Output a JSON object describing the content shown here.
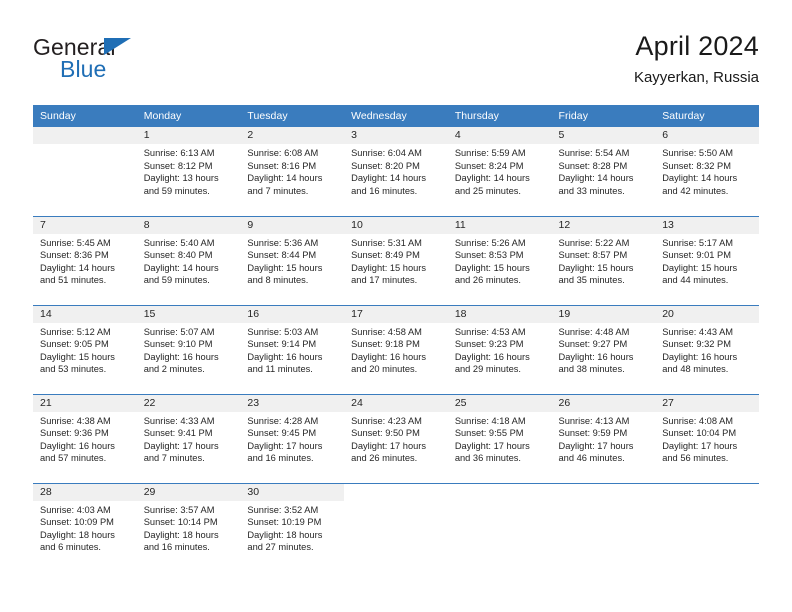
{
  "brand": {
    "name_part1": "General",
    "name_part2": "Blue",
    "accent_color": "#1f6eb5"
  },
  "header": {
    "title": "April 2024",
    "subtitle": "Kayyerkan, Russia"
  },
  "calendar": {
    "header_bg": "#3a7cbe",
    "daynum_bg": "#f0f0f0",
    "weekdays": [
      "Sunday",
      "Monday",
      "Tuesday",
      "Wednesday",
      "Thursday",
      "Friday",
      "Saturday"
    ],
    "weeks": [
      [
        {
          "day": "",
          "sunrise": "",
          "sunset": "",
          "daylight": "",
          "daylight2": "",
          "empty": true
        },
        {
          "day": "1",
          "sunrise": "Sunrise: 6:13 AM",
          "sunset": "Sunset: 8:12 PM",
          "daylight": "Daylight: 13 hours",
          "daylight2": "and 59 minutes."
        },
        {
          "day": "2",
          "sunrise": "Sunrise: 6:08 AM",
          "sunset": "Sunset: 8:16 PM",
          "daylight": "Daylight: 14 hours",
          "daylight2": "and 7 minutes."
        },
        {
          "day": "3",
          "sunrise": "Sunrise: 6:04 AM",
          "sunset": "Sunset: 8:20 PM",
          "daylight": "Daylight: 14 hours",
          "daylight2": "and 16 minutes."
        },
        {
          "day": "4",
          "sunrise": "Sunrise: 5:59 AM",
          "sunset": "Sunset: 8:24 PM",
          "daylight": "Daylight: 14 hours",
          "daylight2": "and 25 minutes."
        },
        {
          "day": "5",
          "sunrise": "Sunrise: 5:54 AM",
          "sunset": "Sunset: 8:28 PM",
          "daylight": "Daylight: 14 hours",
          "daylight2": "and 33 minutes."
        },
        {
          "day": "6",
          "sunrise": "Sunrise: 5:50 AM",
          "sunset": "Sunset: 8:32 PM",
          "daylight": "Daylight: 14 hours",
          "daylight2": "and 42 minutes."
        }
      ],
      [
        {
          "day": "7",
          "sunrise": "Sunrise: 5:45 AM",
          "sunset": "Sunset: 8:36 PM",
          "daylight": "Daylight: 14 hours",
          "daylight2": "and 51 minutes."
        },
        {
          "day": "8",
          "sunrise": "Sunrise: 5:40 AM",
          "sunset": "Sunset: 8:40 PM",
          "daylight": "Daylight: 14 hours",
          "daylight2": "and 59 minutes."
        },
        {
          "day": "9",
          "sunrise": "Sunrise: 5:36 AM",
          "sunset": "Sunset: 8:44 PM",
          "daylight": "Daylight: 15 hours",
          "daylight2": "and 8 minutes."
        },
        {
          "day": "10",
          "sunrise": "Sunrise: 5:31 AM",
          "sunset": "Sunset: 8:49 PM",
          "daylight": "Daylight: 15 hours",
          "daylight2": "and 17 minutes."
        },
        {
          "day": "11",
          "sunrise": "Sunrise: 5:26 AM",
          "sunset": "Sunset: 8:53 PM",
          "daylight": "Daylight: 15 hours",
          "daylight2": "and 26 minutes."
        },
        {
          "day": "12",
          "sunrise": "Sunrise: 5:22 AM",
          "sunset": "Sunset: 8:57 PM",
          "daylight": "Daylight: 15 hours",
          "daylight2": "and 35 minutes."
        },
        {
          "day": "13",
          "sunrise": "Sunrise: 5:17 AM",
          "sunset": "Sunset: 9:01 PM",
          "daylight": "Daylight: 15 hours",
          "daylight2": "and 44 minutes."
        }
      ],
      [
        {
          "day": "14",
          "sunrise": "Sunrise: 5:12 AM",
          "sunset": "Sunset: 9:05 PM",
          "daylight": "Daylight: 15 hours",
          "daylight2": "and 53 minutes."
        },
        {
          "day": "15",
          "sunrise": "Sunrise: 5:07 AM",
          "sunset": "Sunset: 9:10 PM",
          "daylight": "Daylight: 16 hours",
          "daylight2": "and 2 minutes."
        },
        {
          "day": "16",
          "sunrise": "Sunrise: 5:03 AM",
          "sunset": "Sunset: 9:14 PM",
          "daylight": "Daylight: 16 hours",
          "daylight2": "and 11 minutes."
        },
        {
          "day": "17",
          "sunrise": "Sunrise: 4:58 AM",
          "sunset": "Sunset: 9:18 PM",
          "daylight": "Daylight: 16 hours",
          "daylight2": "and 20 minutes."
        },
        {
          "day": "18",
          "sunrise": "Sunrise: 4:53 AM",
          "sunset": "Sunset: 9:23 PM",
          "daylight": "Daylight: 16 hours",
          "daylight2": "and 29 minutes."
        },
        {
          "day": "19",
          "sunrise": "Sunrise: 4:48 AM",
          "sunset": "Sunset: 9:27 PM",
          "daylight": "Daylight: 16 hours",
          "daylight2": "and 38 minutes."
        },
        {
          "day": "20",
          "sunrise": "Sunrise: 4:43 AM",
          "sunset": "Sunset: 9:32 PM",
          "daylight": "Daylight: 16 hours",
          "daylight2": "and 48 minutes."
        }
      ],
      [
        {
          "day": "21",
          "sunrise": "Sunrise: 4:38 AM",
          "sunset": "Sunset: 9:36 PM",
          "daylight": "Daylight: 16 hours",
          "daylight2": "and 57 minutes."
        },
        {
          "day": "22",
          "sunrise": "Sunrise: 4:33 AM",
          "sunset": "Sunset: 9:41 PM",
          "daylight": "Daylight: 17 hours",
          "daylight2": "and 7 minutes."
        },
        {
          "day": "23",
          "sunrise": "Sunrise: 4:28 AM",
          "sunset": "Sunset: 9:45 PM",
          "daylight": "Daylight: 17 hours",
          "daylight2": "and 16 minutes."
        },
        {
          "day": "24",
          "sunrise": "Sunrise: 4:23 AM",
          "sunset": "Sunset: 9:50 PM",
          "daylight": "Daylight: 17 hours",
          "daylight2": "and 26 minutes."
        },
        {
          "day": "25",
          "sunrise": "Sunrise: 4:18 AM",
          "sunset": "Sunset: 9:55 PM",
          "daylight": "Daylight: 17 hours",
          "daylight2": "and 36 minutes."
        },
        {
          "day": "26",
          "sunrise": "Sunrise: 4:13 AM",
          "sunset": "Sunset: 9:59 PM",
          "daylight": "Daylight: 17 hours",
          "daylight2": "and 46 minutes."
        },
        {
          "day": "27",
          "sunrise": "Sunrise: 4:08 AM",
          "sunset": "Sunset: 10:04 PM",
          "daylight": "Daylight: 17 hours",
          "daylight2": "and 56 minutes."
        }
      ],
      [
        {
          "day": "28",
          "sunrise": "Sunrise: 4:03 AM",
          "sunset": "Sunset: 10:09 PM",
          "daylight": "Daylight: 18 hours",
          "daylight2": "and 6 minutes."
        },
        {
          "day": "29",
          "sunrise": "Sunrise: 3:57 AM",
          "sunset": "Sunset: 10:14 PM",
          "daylight": "Daylight: 18 hours",
          "daylight2": "and 16 minutes."
        },
        {
          "day": "30",
          "sunrise": "Sunrise: 3:52 AM",
          "sunset": "Sunset: 10:19 PM",
          "daylight": "Daylight: 18 hours",
          "daylight2": "and 27 minutes."
        },
        {
          "day": "",
          "sunrise": "",
          "sunset": "",
          "daylight": "",
          "daylight2": "",
          "empty": true,
          "blank": true
        },
        {
          "day": "",
          "sunrise": "",
          "sunset": "",
          "daylight": "",
          "daylight2": "",
          "empty": true,
          "blank": true
        },
        {
          "day": "",
          "sunrise": "",
          "sunset": "",
          "daylight": "",
          "daylight2": "",
          "empty": true,
          "blank": true
        },
        {
          "day": "",
          "sunrise": "",
          "sunset": "",
          "daylight": "",
          "daylight2": "",
          "empty": true,
          "blank": true
        }
      ]
    ]
  }
}
